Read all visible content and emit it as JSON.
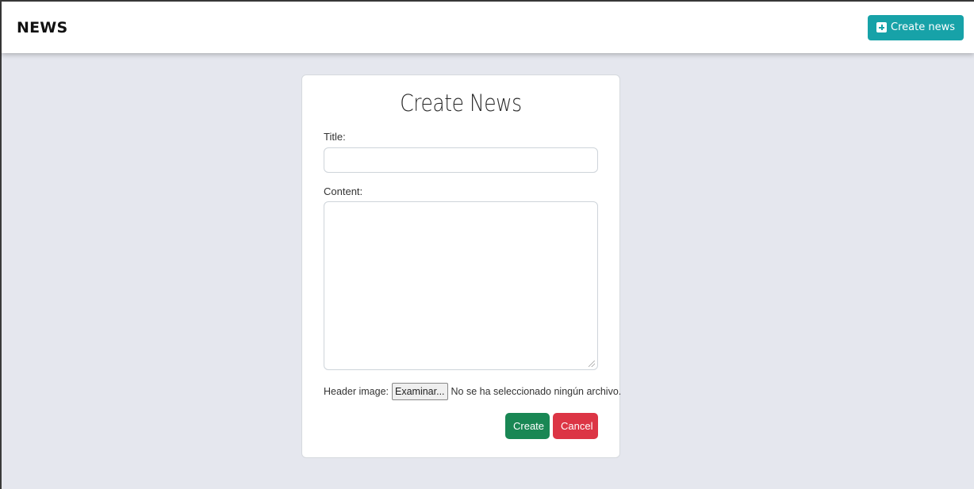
{
  "navbar": {
    "brand": "NEWS",
    "create_button_label": "Create news",
    "create_button_icon": "plus-square-icon"
  },
  "form": {
    "heading": "Create News",
    "title_label": "Title:",
    "title_value": "",
    "content_label": "Content:",
    "content_value": "",
    "header_image_label": "Header image:",
    "file_button_label": "Examinar...",
    "file_status": "No se ha seleccionado ningún archivo.",
    "submit_label": "Create",
    "cancel_label": "Cancel"
  },
  "colors": {
    "page_background": "#e5e7ee",
    "accent_teal": "#17a2a8",
    "create_green": "#198754",
    "cancel_red": "#dc3545"
  }
}
